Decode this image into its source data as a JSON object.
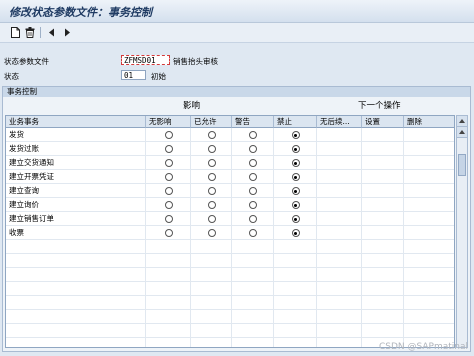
{
  "window": {
    "title": "修改状态参数文件：事务控制"
  },
  "toolbar": {
    "icons": [
      "new-document-icon",
      "delete-icon",
      "previous-icon",
      "next-icon"
    ]
  },
  "header": {
    "profile_label": "状态参数文件",
    "profile_value": "ZFMSD01",
    "profile_desc": "销售抬头审核",
    "status_label": "状态",
    "status_value": "01",
    "status_desc": "初始"
  },
  "control": {
    "group_title": "事务控制",
    "band_influence": "影响",
    "band_next": "下一个操作",
    "columns": [
      "业务事务",
      "无影响",
      "已允许",
      "警告",
      "禁止",
      "无后续...",
      "设置",
      "删除"
    ],
    "rows": [
      {
        "name": "发货",
        "selected": 4
      },
      {
        "name": "发货过账",
        "selected": 4
      },
      {
        "name": "建立交货通知",
        "selected": 4
      },
      {
        "name": "建立开票凭证",
        "selected": 4
      },
      {
        "name": "建立查询",
        "selected": 4
      },
      {
        "name": "建立询价",
        "selected": 4
      },
      {
        "name": "建立销售订单",
        "selected": 4
      },
      {
        "name": "收票",
        "selected": 4
      }
    ]
  },
  "watermark": "CSDN @SAPmatinal"
}
